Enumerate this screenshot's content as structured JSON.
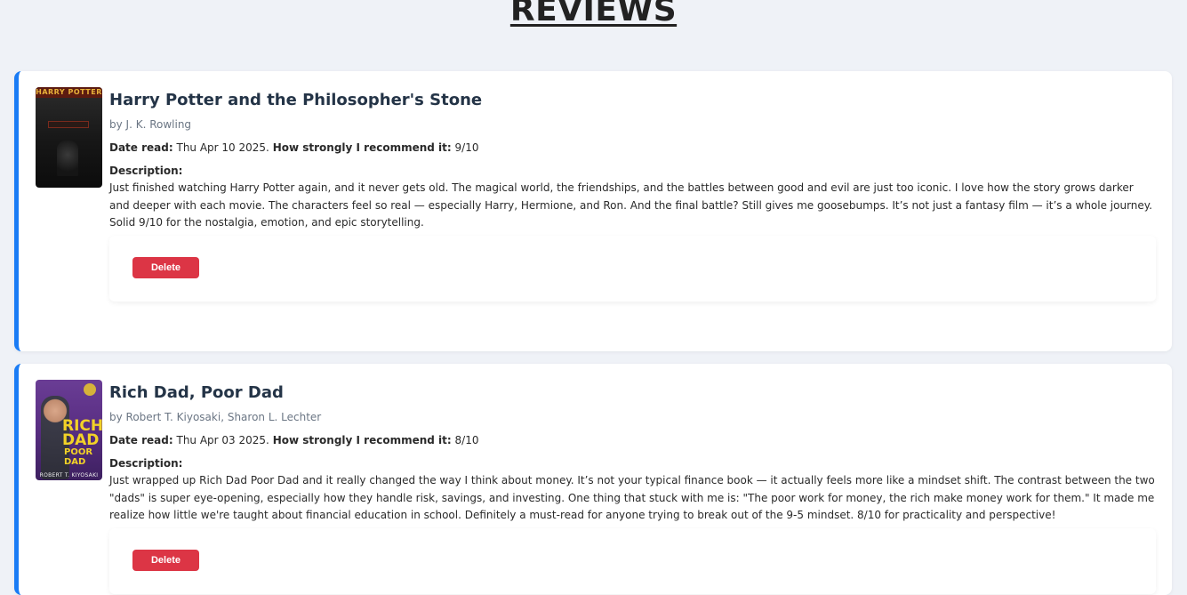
{
  "page": {
    "heading": "REVIEWS"
  },
  "reviews": [
    {
      "title": "Harry Potter and the Philosopher's Stone",
      "author": "by J. K. Rowling",
      "date_label": "Date read:",
      "date_value": "Thu Apr 10 2025.",
      "recommend_label": "How strongly I recommend it:",
      "recommend_value": "9/10",
      "description_label": "Description:",
      "description": "Just finished watching Harry Potter again, and it never gets old. The magical world, the friendships, and the battles between good and evil are just too iconic. I love how the story grows darker and deeper with each movie. The characters feel so real — especially Harry, Hermione, and Ron. And the final battle? Still gives me goosebumps. It’s not just a fantasy film — it’s a whole journey. Solid 9/10 for the nostalgia, emotion, and epic storytelling.",
      "delete_label": "Delete",
      "cover": {
        "title_text": "HARRY POTTER",
        "accent_color": "#e8b23a"
      }
    },
    {
      "title": "Rich Dad, Poor Dad",
      "author": "by Robert T. Kiyosaki, Sharon L. Lechter",
      "date_label": "Date read:",
      "date_value": "Thu Apr 03 2025.",
      "recommend_label": "How strongly I recommend it:",
      "recommend_value": "8/10",
      "description_label": "Description:",
      "description": "Just wrapped up Rich Dad Poor Dad and it really changed the way I think about money. It’s not your typical finance book — it actually feels more like a mindset shift. The contrast between the two \"dads\" is super eye-opening, especially how they handle risk, savings, and investing. One thing that stuck with me is: \"The poor work for money, the rich make money work for them.\" It made me realize how little we're taught about financial education in school. Definitely a must-read for anyone trying to break out of the 9-5 mindset. 8/10 for practicality and perspective!",
      "delete_label": "Delete",
      "cover": {
        "rich_text": "RICH DAD",
        "poor_text": "POOR DAD",
        "author_text": "ROBERT T. KIYOSAKI",
        "accent_color": "#f2d227"
      }
    }
  ],
  "colors": {
    "accent_border": "#1a7cf5",
    "delete_button": "#dc3545",
    "background": "#eff2f7"
  }
}
